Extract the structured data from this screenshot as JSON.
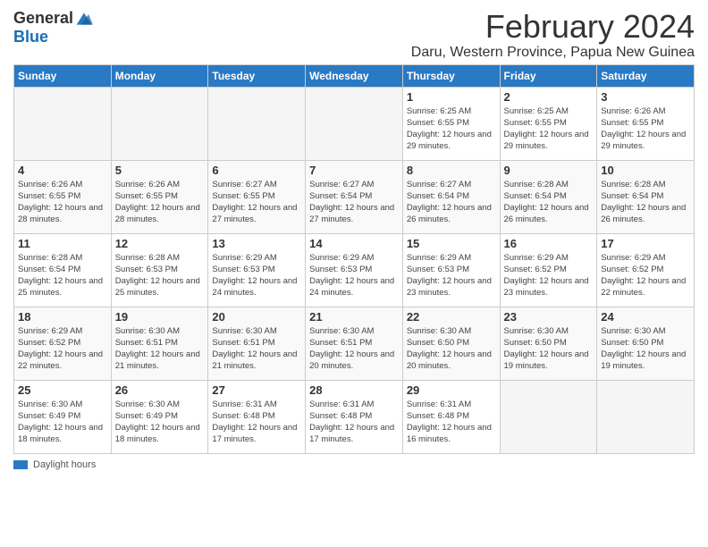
{
  "logo": {
    "general": "General",
    "blue": "Blue"
  },
  "title": {
    "month": "February 2024",
    "location": "Daru, Western Province, Papua New Guinea"
  },
  "days_of_week": [
    "Sunday",
    "Monday",
    "Tuesday",
    "Wednesday",
    "Thursday",
    "Friday",
    "Saturday"
  ],
  "weeks": [
    [
      {
        "day": "",
        "info": ""
      },
      {
        "day": "",
        "info": ""
      },
      {
        "day": "",
        "info": ""
      },
      {
        "day": "",
        "info": ""
      },
      {
        "day": "1",
        "info": "Sunrise: 6:25 AM\nSunset: 6:55 PM\nDaylight: 12 hours and 29 minutes."
      },
      {
        "day": "2",
        "info": "Sunrise: 6:25 AM\nSunset: 6:55 PM\nDaylight: 12 hours and 29 minutes."
      },
      {
        "day": "3",
        "info": "Sunrise: 6:26 AM\nSunset: 6:55 PM\nDaylight: 12 hours and 29 minutes."
      }
    ],
    [
      {
        "day": "4",
        "info": "Sunrise: 6:26 AM\nSunset: 6:55 PM\nDaylight: 12 hours and 28 minutes."
      },
      {
        "day": "5",
        "info": "Sunrise: 6:26 AM\nSunset: 6:55 PM\nDaylight: 12 hours and 28 minutes."
      },
      {
        "day": "6",
        "info": "Sunrise: 6:27 AM\nSunset: 6:55 PM\nDaylight: 12 hours and 27 minutes."
      },
      {
        "day": "7",
        "info": "Sunrise: 6:27 AM\nSunset: 6:54 PM\nDaylight: 12 hours and 27 minutes."
      },
      {
        "day": "8",
        "info": "Sunrise: 6:27 AM\nSunset: 6:54 PM\nDaylight: 12 hours and 26 minutes."
      },
      {
        "day": "9",
        "info": "Sunrise: 6:28 AM\nSunset: 6:54 PM\nDaylight: 12 hours and 26 minutes."
      },
      {
        "day": "10",
        "info": "Sunrise: 6:28 AM\nSunset: 6:54 PM\nDaylight: 12 hours and 26 minutes."
      }
    ],
    [
      {
        "day": "11",
        "info": "Sunrise: 6:28 AM\nSunset: 6:54 PM\nDaylight: 12 hours and 25 minutes."
      },
      {
        "day": "12",
        "info": "Sunrise: 6:28 AM\nSunset: 6:53 PM\nDaylight: 12 hours and 25 minutes."
      },
      {
        "day": "13",
        "info": "Sunrise: 6:29 AM\nSunset: 6:53 PM\nDaylight: 12 hours and 24 minutes."
      },
      {
        "day": "14",
        "info": "Sunrise: 6:29 AM\nSunset: 6:53 PM\nDaylight: 12 hours and 24 minutes."
      },
      {
        "day": "15",
        "info": "Sunrise: 6:29 AM\nSunset: 6:53 PM\nDaylight: 12 hours and 23 minutes."
      },
      {
        "day": "16",
        "info": "Sunrise: 6:29 AM\nSunset: 6:52 PM\nDaylight: 12 hours and 23 minutes."
      },
      {
        "day": "17",
        "info": "Sunrise: 6:29 AM\nSunset: 6:52 PM\nDaylight: 12 hours and 22 minutes."
      }
    ],
    [
      {
        "day": "18",
        "info": "Sunrise: 6:29 AM\nSunset: 6:52 PM\nDaylight: 12 hours and 22 minutes."
      },
      {
        "day": "19",
        "info": "Sunrise: 6:30 AM\nSunset: 6:51 PM\nDaylight: 12 hours and 21 minutes."
      },
      {
        "day": "20",
        "info": "Sunrise: 6:30 AM\nSunset: 6:51 PM\nDaylight: 12 hours and 21 minutes."
      },
      {
        "day": "21",
        "info": "Sunrise: 6:30 AM\nSunset: 6:51 PM\nDaylight: 12 hours and 20 minutes."
      },
      {
        "day": "22",
        "info": "Sunrise: 6:30 AM\nSunset: 6:50 PM\nDaylight: 12 hours and 20 minutes."
      },
      {
        "day": "23",
        "info": "Sunrise: 6:30 AM\nSunset: 6:50 PM\nDaylight: 12 hours and 19 minutes."
      },
      {
        "day": "24",
        "info": "Sunrise: 6:30 AM\nSunset: 6:50 PM\nDaylight: 12 hours and 19 minutes."
      }
    ],
    [
      {
        "day": "25",
        "info": "Sunrise: 6:30 AM\nSunset: 6:49 PM\nDaylight: 12 hours and 18 minutes."
      },
      {
        "day": "26",
        "info": "Sunrise: 6:30 AM\nSunset: 6:49 PM\nDaylight: 12 hours and 18 minutes."
      },
      {
        "day": "27",
        "info": "Sunrise: 6:31 AM\nSunset: 6:48 PM\nDaylight: 12 hours and 17 minutes."
      },
      {
        "day": "28",
        "info": "Sunrise: 6:31 AM\nSunset: 6:48 PM\nDaylight: 12 hours and 17 minutes."
      },
      {
        "day": "29",
        "info": "Sunrise: 6:31 AM\nSunset: 6:48 PM\nDaylight: 12 hours and 16 minutes."
      },
      {
        "day": "",
        "info": ""
      },
      {
        "day": "",
        "info": ""
      }
    ]
  ],
  "footer": {
    "daylight_label": "Daylight hours"
  }
}
